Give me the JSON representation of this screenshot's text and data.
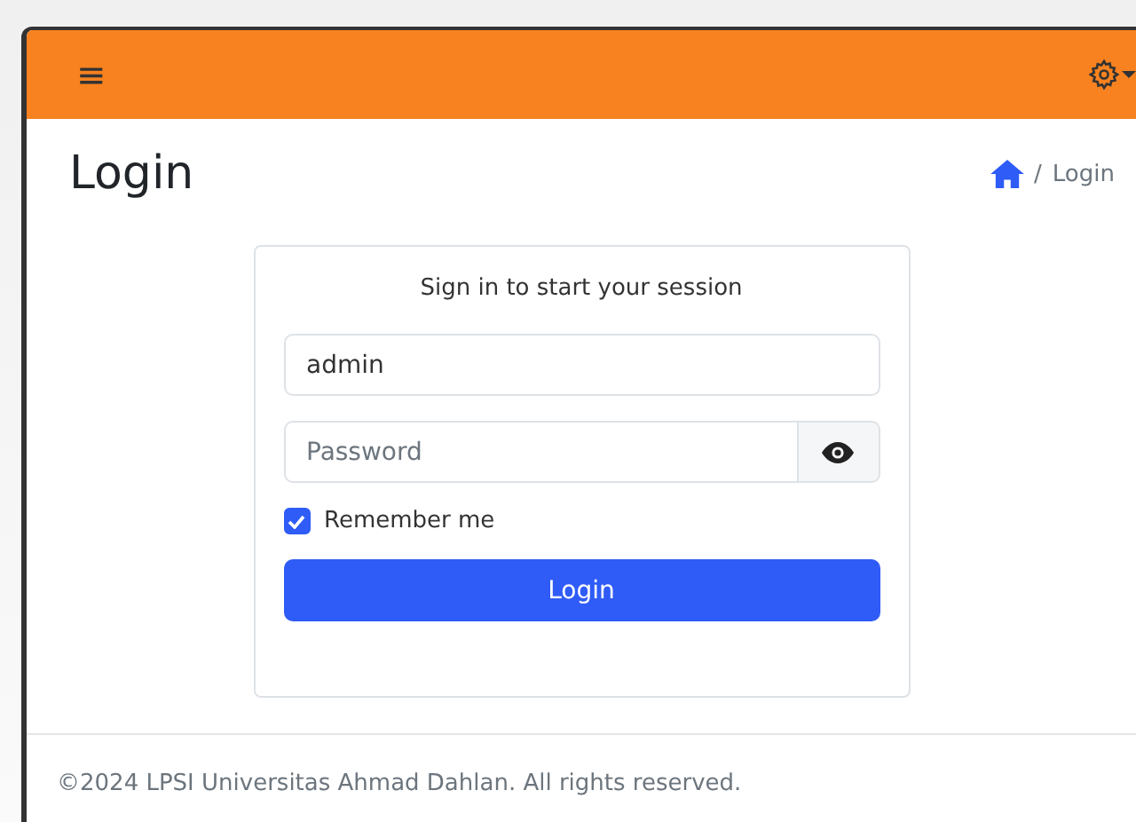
{
  "navbar": {
    "menu_icon": "≡"
  },
  "page": {
    "title": "Login",
    "breadcrumb_separator": "/",
    "breadcrumb": [
      "Login"
    ]
  },
  "login_box": {
    "heading": "Sign in to start your session",
    "username": {
      "value": "admin"
    },
    "password": {
      "placeholder": "Password"
    },
    "remember": {
      "label": "Remember me",
      "checked": true
    },
    "submit": "Login"
  },
  "footer": "©2024 LPSI Universitas Ahmad Dahlan. All rights reserved."
}
